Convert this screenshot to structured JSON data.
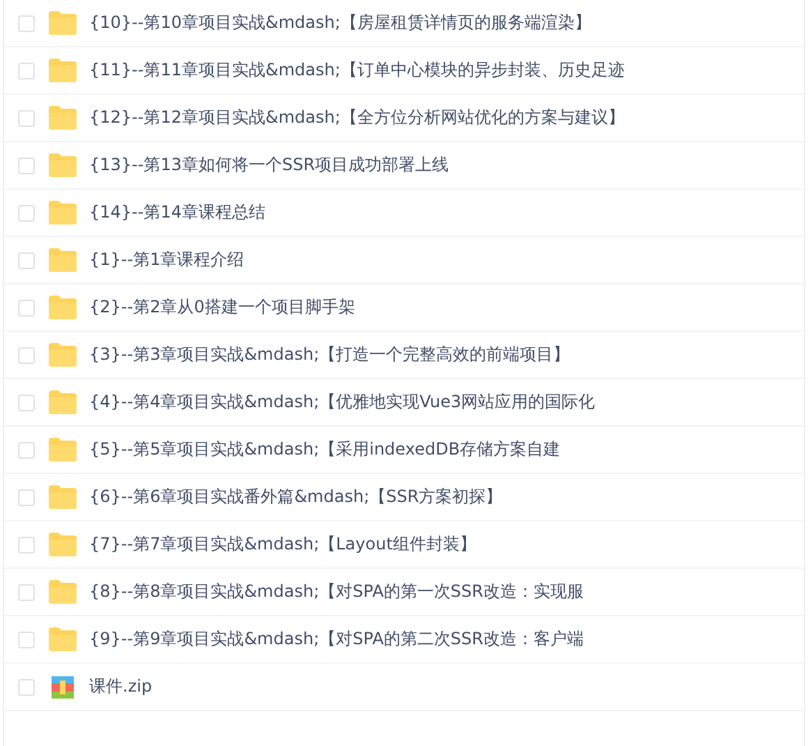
{
  "files": [
    {
      "kind": "folder",
      "checked": false,
      "name": "{10}--第10章项目实战&mdash;【房屋租赁详情页的服务端渲染】"
    },
    {
      "kind": "folder",
      "checked": false,
      "name": "{11}--第11章项目实战&mdash;【订单中心模块的异步封装、历史足迹"
    },
    {
      "kind": "folder",
      "checked": false,
      "name": "{12}--第12章项目实战&mdash;【全方位分析网站优化的方案与建议】"
    },
    {
      "kind": "folder",
      "checked": false,
      "name": "{13}--第13章如何将一个SSR项目成功部署上线"
    },
    {
      "kind": "folder",
      "checked": false,
      "name": "{14}--第14章课程总结"
    },
    {
      "kind": "folder",
      "checked": false,
      "name": "{1}--第1章课程介绍"
    },
    {
      "kind": "folder",
      "checked": false,
      "name": "{2}--第2章从0搭建一个项目脚手架"
    },
    {
      "kind": "folder",
      "checked": false,
      "name": "{3}--第3章项目实战&mdash;【打造一个完整高效的前端项目】"
    },
    {
      "kind": "folder",
      "checked": false,
      "name": "{4}--第4章项目实战&mdash;【优雅地实现Vue3网站应用的国际化"
    },
    {
      "kind": "folder",
      "checked": false,
      "name": "{5}--第5章项目实战&mdash;【采用indexedDB存储方案自建"
    },
    {
      "kind": "folder",
      "checked": false,
      "name": "{6}--第6章项目实战番外篇&mdash;【SSR方案初探】"
    },
    {
      "kind": "folder",
      "checked": false,
      "name": "{7}--第7章项目实战&mdash;【Layout组件封装】"
    },
    {
      "kind": "folder",
      "checked": false,
      "name": "{8}--第8章项目实战&mdash;【对SPA的第一次SSR改造：实现服"
    },
    {
      "kind": "folder",
      "checked": false,
      "name": "{9}--第9章项目实战&mdash;【对SPA的第二次SSR改造：客户端"
    },
    {
      "kind": "zip",
      "checked": false,
      "name": "课件.zip"
    }
  ]
}
